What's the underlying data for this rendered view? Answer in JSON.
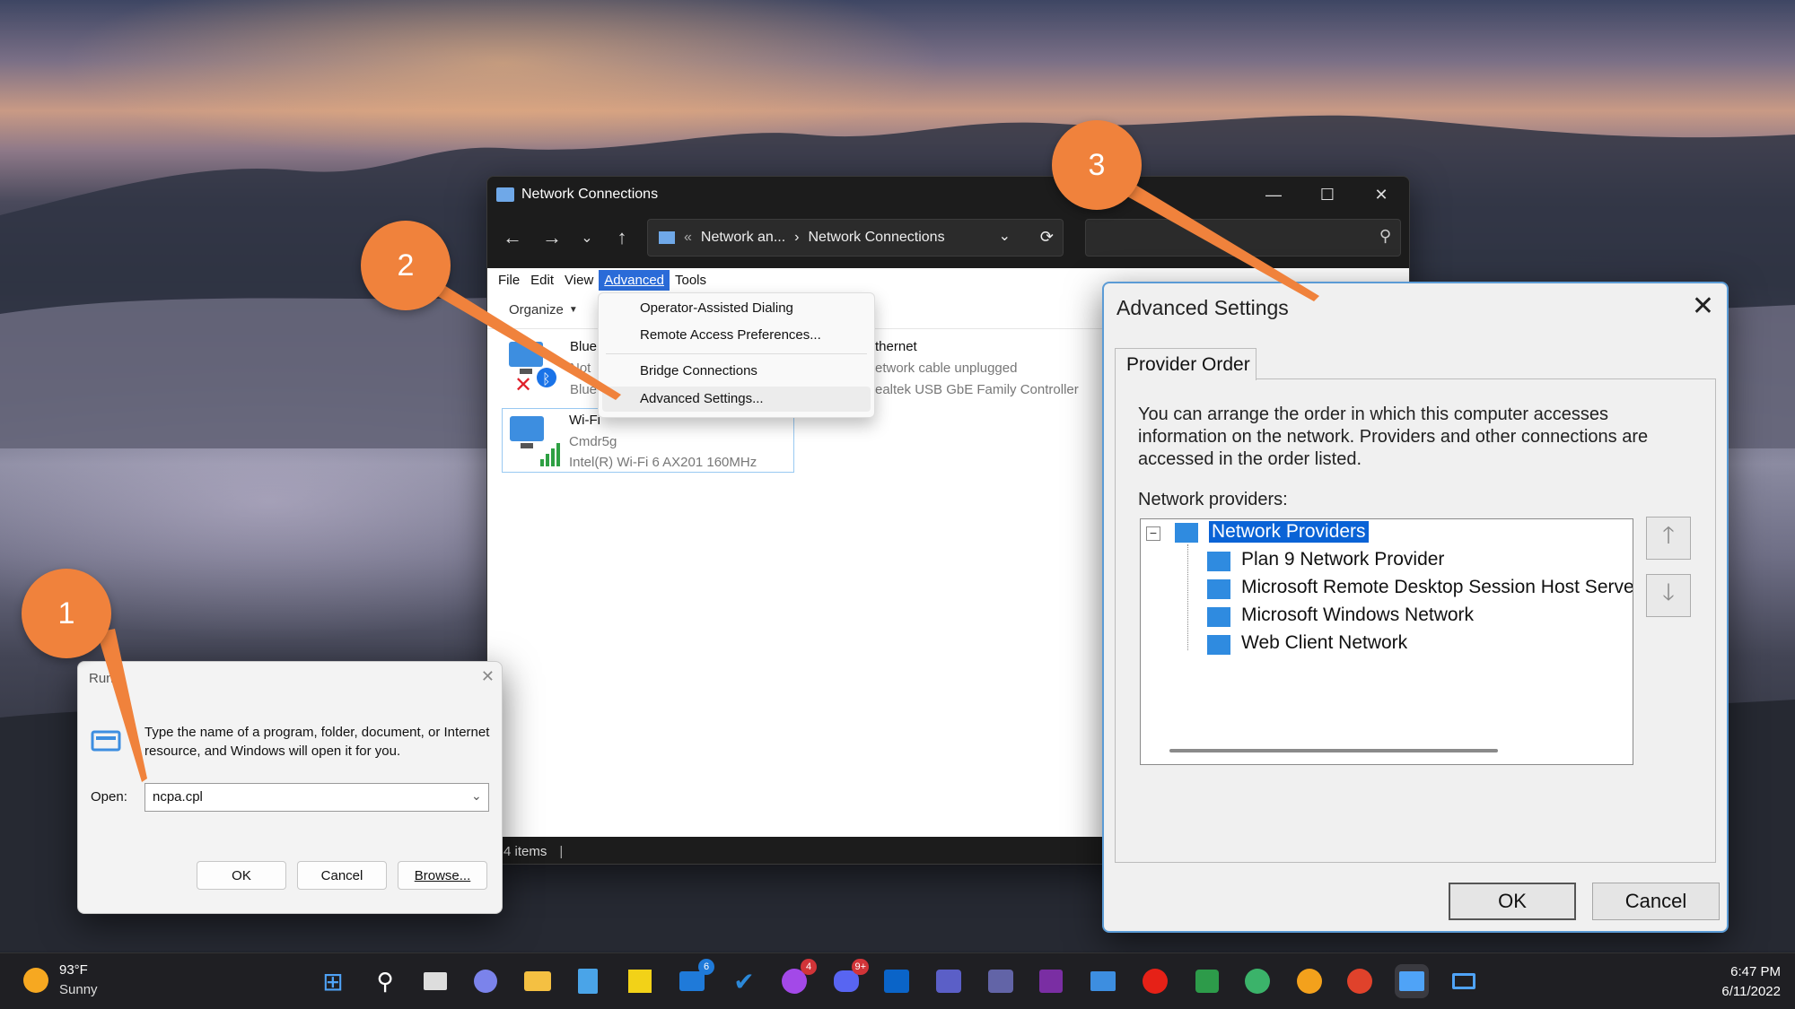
{
  "network_connections": {
    "title": "Network Connections",
    "breadcrumb": [
      "Network an...",
      "Network Connections"
    ],
    "menu": [
      "File",
      "Edit",
      "View",
      "Advanced",
      "Tools"
    ],
    "organize": "Organize",
    "items": [
      {
        "name": "Blue",
        "line2": "Not",
        "line3": "Blue"
      },
      {
        "name": "Wi-Fi",
        "line2": "Cmdr5g",
        "line3": "Intel(R) Wi-Fi 6 AX201 160MHz"
      },
      {
        "name": "thernet",
        "line2": "etwork cable unplugged",
        "line3": "ealtek USB GbE Family Controller"
      }
    ],
    "status": "4 items",
    "advanced_menu": [
      "Operator-Assisted Dialing",
      "Remote Access Preferences...",
      "Bridge Connections",
      "Advanced Settings..."
    ]
  },
  "advanced_settings": {
    "title": "Advanced Settings",
    "tab": "Provider Order",
    "description": "You can arrange the order in which this computer accesses information on the network.  Providers and other connections are accessed in the order listed.",
    "providers_label": "Network providers:",
    "root": "Network Providers",
    "providers": [
      "Plan 9 Network Provider",
      "Microsoft Remote Desktop Session Host Serve",
      "Microsoft Windows Network",
      "Web Client Network"
    ],
    "ok": "OK",
    "cancel": "Cancel"
  },
  "run": {
    "title": "Run",
    "description": "Type the name of a program, folder, document, or Internet resource, and Windows will open it for you.",
    "open_label": "Open:",
    "value": "ncpa.cpl",
    "ok": "OK",
    "cancel": "Cancel",
    "browse": "Browse..."
  },
  "callouts": [
    "1",
    "2",
    "3"
  ],
  "taskbar": {
    "temp": "93°F",
    "weather": "Sunny",
    "time": "6:47 PM",
    "date": "6/11/2022",
    "badges": {
      "mail": "6",
      "messenger": "4",
      "discord": "9+"
    }
  },
  "colors": {
    "accent": "#0a63d6",
    "callout": "#f0823c",
    "dialog_border": "#5b9bd5"
  }
}
